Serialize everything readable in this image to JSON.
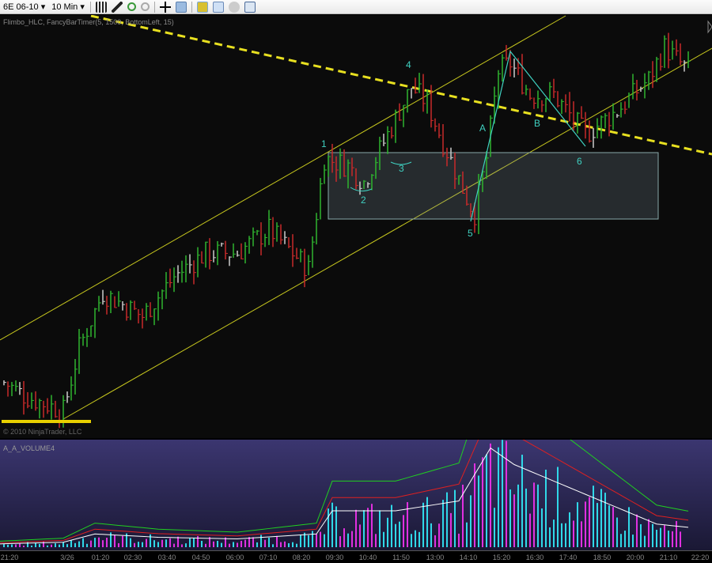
{
  "toolbar": {
    "instrument": "6E 06-10",
    "interval": "10 Min",
    "dropdown_arrow": "▾",
    "icons": [
      "bar-style-icon",
      "drawing-pen-icon",
      "zoom-in-icon",
      "zoom-out-icon",
      "crosshair-icon",
      "properties-icon",
      "data-box-icon",
      "indicators-icon",
      "strategy-icon",
      "chart-trader-icon"
    ]
  },
  "chart": {
    "indicator_label": "Flimbo_HLC, FancyBarTimer(5, 1500, BottomLeft, 15)",
    "copyright": "© 2010 NinjaTrader, LLC",
    "annotations": [
      {
        "t": "1"
      },
      {
        "t": "2"
      },
      {
        "t": "3"
      },
      {
        "t": "4"
      },
      {
        "t": "5"
      },
      {
        "t": "6"
      },
      {
        "t": "A"
      },
      {
        "t": "B"
      }
    ],
    "colors": {
      "up": "#2fb52f",
      "down": "#c82a2a",
      "neutral": "#cccccc",
      "channel": "#c8c81e",
      "trend": "#e8e020",
      "annot": "#3fd0c0"
    }
  },
  "chart_data": {
    "type": "ohlc",
    "note": "price path keypoints, relative units",
    "price_keypoints": [
      [
        0,
        14
      ],
      [
        30,
        10
      ],
      [
        80,
        6
      ],
      [
        100,
        22
      ],
      [
        130,
        36
      ],
      [
        180,
        30
      ],
      [
        220,
        40
      ],
      [
        260,
        46
      ],
      [
        300,
        46
      ],
      [
        340,
        52
      ],
      [
        390,
        42
      ],
      [
        410,
        70
      ],
      [
        440,
        68
      ],
      [
        460,
        64
      ],
      [
        490,
        76
      ],
      [
        520,
        88
      ],
      [
        540,
        84
      ],
      [
        560,
        74
      ],
      [
        590,
        60
      ],
      [
        600,
        56
      ],
      [
        615,
        70
      ],
      [
        630,
        92
      ],
      [
        645,
        94
      ],
      [
        670,
        86
      ],
      [
        700,
        86
      ],
      [
        740,
        76
      ],
      [
        780,
        82
      ],
      [
        820,
        90
      ],
      [
        840,
        98
      ],
      [
        870,
        92
      ]
    ],
    "volume_keypoints": [
      [
        0,
        2
      ],
      [
        80,
        3
      ],
      [
        120,
        8
      ],
      [
        200,
        6
      ],
      [
        300,
        5
      ],
      [
        400,
        8
      ],
      [
        420,
        22
      ],
      [
        500,
        22
      ],
      [
        580,
        28
      ],
      [
        620,
        60
      ],
      [
        650,
        50
      ],
      [
        700,
        40
      ],
      [
        760,
        28
      ],
      [
        830,
        14
      ],
      [
        870,
        12
      ]
    ]
  },
  "volume": {
    "label": "A_A_VOLUME4"
  },
  "xaxis": {
    "labels": [
      "21:20",
      "3/26",
      "01:20",
      "02:30",
      "03:40",
      "04:50",
      "06:00",
      "07:10",
      "08:20",
      "09:30",
      "10:40",
      "11:50",
      "13:00",
      "14:10",
      "15:20",
      "16:30",
      "17:40",
      "18:50",
      "20:00",
      "21:10",
      "22:20"
    ]
  }
}
